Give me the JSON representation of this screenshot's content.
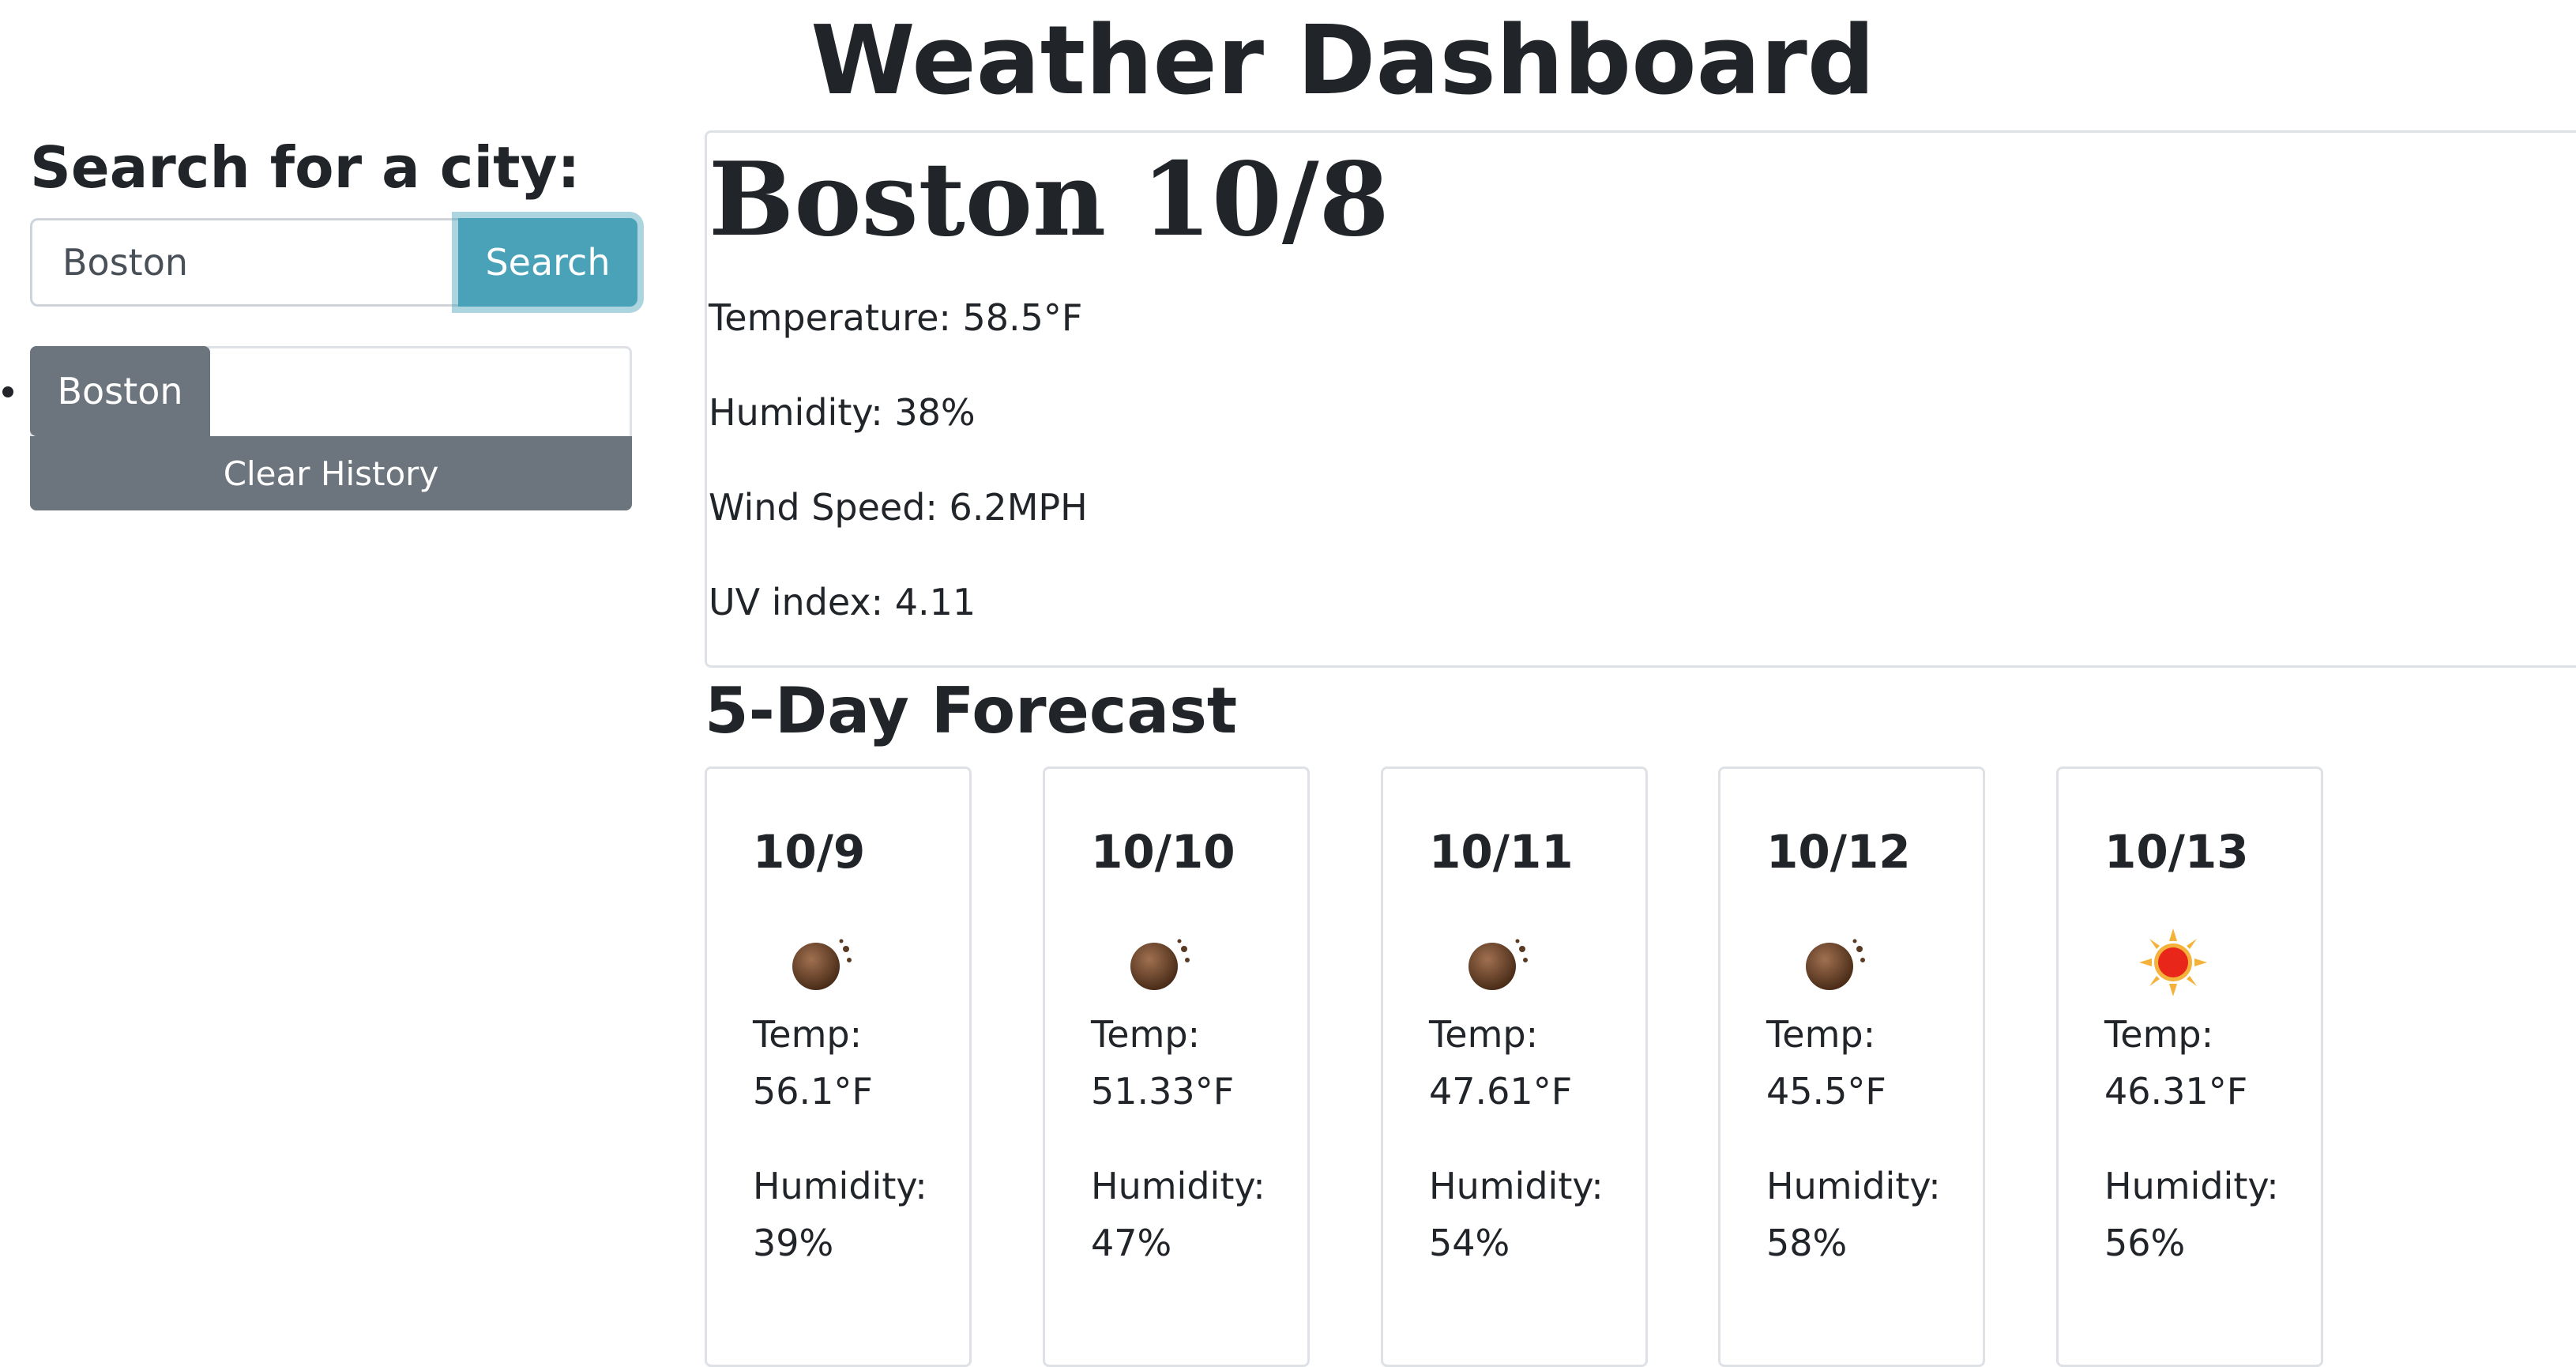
{
  "header": {
    "title": "Weather Dashboard"
  },
  "sidebar": {
    "heading": "Search for a city:",
    "search_value": "Boston",
    "search_button": "Search",
    "history": [
      {
        "label": "Boston"
      }
    ],
    "clear_button": "Clear History"
  },
  "current": {
    "title": "Boston 10/8",
    "temperature": "Temperature: 58.5°F",
    "humidity": "Humidity: 38%",
    "wind": "Wind Speed: 6.2MPH",
    "uv": "UV index: 4.11"
  },
  "forecast": {
    "heading": "5-Day Forecast",
    "days": [
      {
        "date": "10/9",
        "icon": "light-rain-icon",
        "temp_label": "Temp:",
        "temp": "56.1°F",
        "humidity_label": "Humidity:",
        "humidity": "39%"
      },
      {
        "date": "10/10",
        "icon": "light-rain-icon",
        "temp_label": "Temp:",
        "temp": "51.33°F",
        "humidity_label": "Humidity:",
        "humidity": "47%"
      },
      {
        "date": "10/11",
        "icon": "light-rain-icon",
        "temp_label": "Temp:",
        "temp": "47.61°F",
        "humidity_label": "Humidity:",
        "humidity": "54%"
      },
      {
        "date": "10/12",
        "icon": "light-rain-icon",
        "temp_label": "Temp:",
        "temp": "45.5°F",
        "humidity_label": "Humidity:",
        "humidity": "58%"
      },
      {
        "date": "10/13",
        "icon": "clear-sun-icon",
        "temp_label": "Temp:",
        "temp": "46.31°F",
        "humidity_label": "Humidity:",
        "humidity": "56%"
      }
    ]
  },
  "colors": {
    "accent": "#4aa2b8",
    "secondary": "#6c757d",
    "border": "#dee2e6",
    "text": "#212529"
  }
}
